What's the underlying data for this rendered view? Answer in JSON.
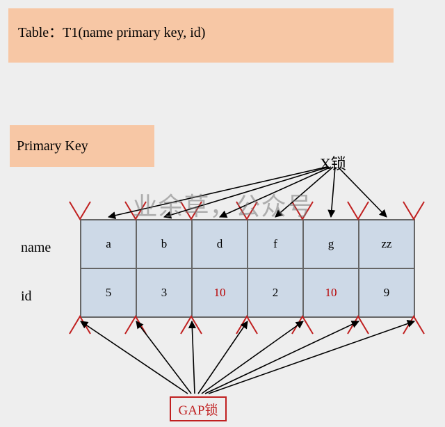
{
  "header": {
    "text": "Table：T1(name primary key, id)"
  },
  "pk_label": "Primary Key",
  "x_lock_label": "X锁",
  "gap_lock_label": "GAP锁",
  "watermark": "业余草，公众号",
  "row_labels": {
    "name": "name",
    "id": "id"
  },
  "table": {
    "names": [
      "a",
      "b",
      "d",
      "f",
      "g",
      "zz"
    ],
    "ids": [
      "5",
      "3",
      "10",
      "2",
      "10",
      "9"
    ],
    "id_red": [
      false,
      false,
      true,
      false,
      true,
      false
    ]
  },
  "colors": {
    "header_bg": "#f7c7a5",
    "cell_bg": "#cdd9e7",
    "red": "#c02020",
    "arrow": "#000"
  }
}
